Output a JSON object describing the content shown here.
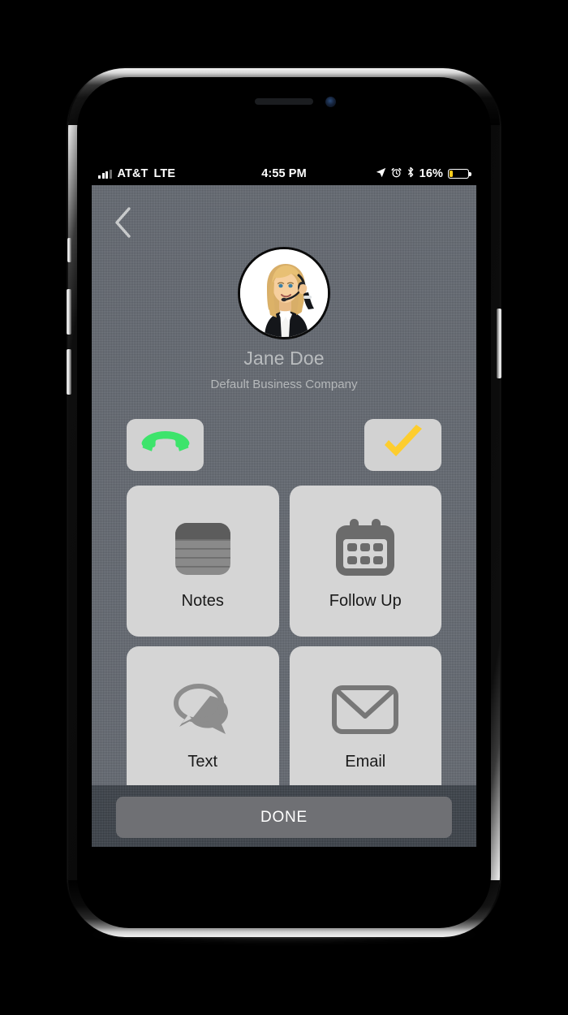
{
  "status_bar": {
    "carrier": "AT&T",
    "network": "LTE",
    "time": "4:55 PM",
    "battery_percent": "16%",
    "battery_level": 16,
    "battery_color": "#fdcd1b",
    "icons": [
      "signal-bars-icon",
      "location-arrow-icon",
      "alarm-clock-icon",
      "bluetooth-icon",
      "battery-icon"
    ]
  },
  "screen": {
    "background_color": "#6a7078",
    "back_button": "back-chevron-icon"
  },
  "contact": {
    "name": "Jane Doe",
    "company": "Default Business Company",
    "avatar": "contact-photo-headset-woman"
  },
  "actions": [
    {
      "name": "call",
      "icon": "phone-handset-icon",
      "color": "#3de46b"
    },
    {
      "name": "complete",
      "icon": "checkmark-icon",
      "color": "#fdcd2e"
    }
  ],
  "tiles": [
    {
      "label": "Notes",
      "icon": "notes-icon"
    },
    {
      "label": "Follow Up",
      "icon": "calendar-icon"
    },
    {
      "label": "Text",
      "icon": "speech-bubbles-icon"
    },
    {
      "label": "Email",
      "icon": "envelope-icon"
    }
  ],
  "footer": {
    "done_label": "DONE"
  }
}
